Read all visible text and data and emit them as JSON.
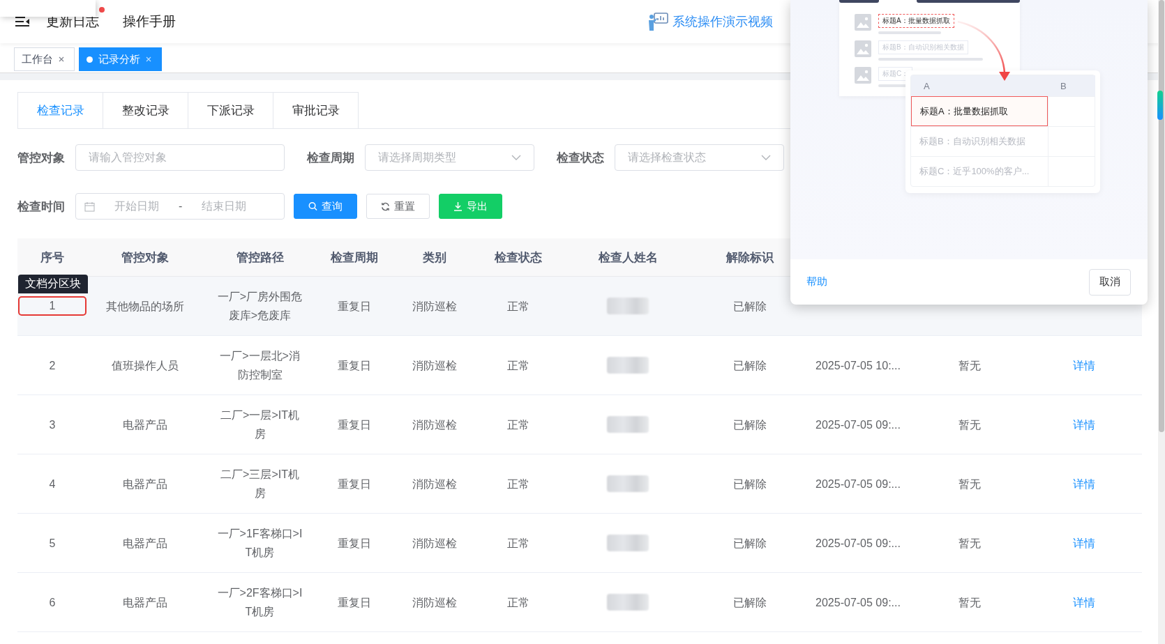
{
  "header": {
    "links": [
      {
        "label": "更新日志",
        "badge": true
      },
      {
        "label": "操作手册",
        "badge": false
      }
    ],
    "video_link": "系统操作演示视频"
  },
  "page_tabs": [
    {
      "label": "工作台",
      "selected": false
    },
    {
      "label": "记录分析",
      "selected": true
    }
  ],
  "sub_tabs": [
    {
      "label": "检查记录",
      "selected": true
    },
    {
      "label": "整改记录",
      "selected": false
    },
    {
      "label": "下派记录",
      "selected": false
    },
    {
      "label": "审批记录",
      "selected": false
    }
  ],
  "filters": [
    {
      "kind": "input",
      "label": "管控对象",
      "placeholder": "请输入管控对象"
    },
    {
      "kind": "select",
      "label": "检查周期",
      "placeholder": "请选择周期类型"
    },
    {
      "kind": "select",
      "label": "检查状态",
      "placeholder": "请选择检查状态"
    }
  ],
  "date_filter": {
    "label": "检查时间",
    "start_placeholder": "开始日期",
    "separator": "-",
    "end_placeholder": "结束日期"
  },
  "buttons": [
    {
      "kind": "primary",
      "label": "查询"
    },
    {
      "kind": "default",
      "label": "重置"
    },
    {
      "kind": "success",
      "label": "导出"
    }
  ],
  "table": {
    "columns": [
      "序号",
      "管控对象",
      "管控路径",
      "检查周期",
      "类别",
      "检查状态",
      "检查人姓名",
      "解除标识"
    ],
    "rows": [
      {
        "seq": "1",
        "object": "其他物品的场所",
        "path": "一厂>厂房外围危废库>危废库",
        "period": "重复日",
        "category": "消防巡检",
        "status": "正常",
        "released": "已解除",
        "highlighted": true,
        "outlined": true,
        "tooltip": "文档分区块"
      },
      {
        "seq": "2",
        "object": "值班操作人员",
        "path": "一厂>一层北>消防控制室",
        "period": "重复日",
        "category": "消防巡检",
        "status": "正常",
        "released": "已解除",
        "time": "2025-07-05 10:...",
        "column_10": "暂无",
        "action": "详情",
        "highlighted": false,
        "outlined": false
      },
      {
        "seq": "3",
        "object": "电器产品",
        "path": "二厂>一层>IT机房",
        "period": "重复日",
        "category": "消防巡检",
        "status": "正常",
        "released": "已解除",
        "time": "2025-07-05 09:...",
        "column_10": "暂无",
        "action": "详情",
        "highlighted": false,
        "outlined": false
      },
      {
        "seq": "4",
        "object": "电器产品",
        "path": "二厂>三层>IT机房",
        "period": "重复日",
        "category": "消防巡检",
        "status": "正常",
        "released": "已解除",
        "time": "2025-07-05 09:...",
        "column_10": "暂无",
        "action": "详情",
        "highlighted": false,
        "outlined": false
      },
      {
        "seq": "5",
        "object": "电器产品",
        "path": "一厂>1F客梯口>IT机房",
        "period": "重复日",
        "category": "消防巡检",
        "status": "正常",
        "released": "已解除",
        "time": "2025-07-05 09:...",
        "column_10": "暂无",
        "action": "详情",
        "highlighted": false,
        "outlined": false
      },
      {
        "seq": "6",
        "object": "电器产品",
        "path": "一厂>2F客梯口>IT机房",
        "period": "重复日",
        "category": "消防巡检",
        "status": "正常",
        "released": "已解除",
        "time": "2025-07-05 09:...",
        "column_10": "暂无",
        "action": "详情",
        "highlighted": false,
        "outlined": false
      }
    ]
  },
  "dialog": {
    "illustration": {
      "source_items": [
        {
          "text": "标题A：批量数据抓取",
          "selected": true
        },
        {
          "text": "标题B：自动识别相关数据",
          "selected": false
        },
        {
          "text": "标题C：",
          "selected": false
        }
      ],
      "columns": [
        "A",
        "B"
      ],
      "cells": [
        {
          "text": "标题A：批量数据抓取",
          "selected": true
        },
        {
          "text": "标题B：自动识别相关数据",
          "selected": false
        },
        {
          "text": "标题C：近乎100%的客户...",
          "selected": false
        }
      ]
    },
    "help_link": "帮助",
    "cancel_button": "取消"
  }
}
